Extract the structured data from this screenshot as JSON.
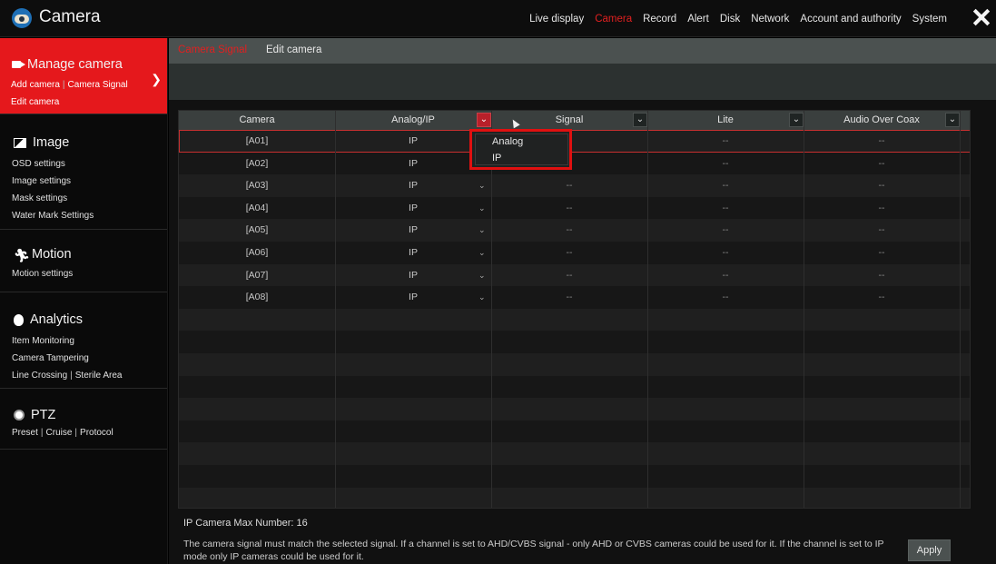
{
  "app": {
    "title": "Camera"
  },
  "topnav": [
    {
      "label": "Live display",
      "active": false
    },
    {
      "label": "Camera",
      "active": true
    },
    {
      "label": "Record",
      "active": false
    },
    {
      "label": "Alert",
      "active": false
    },
    {
      "label": "Disk",
      "active": false
    },
    {
      "label": "Network",
      "active": false
    },
    {
      "label": "Account and authority",
      "active": false
    },
    {
      "label": "System",
      "active": false
    }
  ],
  "sidebar": {
    "manage": {
      "title": "Manage camera",
      "links": [
        "Add camera",
        "Camera Signal",
        "Edit camera"
      ]
    },
    "image": {
      "title": "Image",
      "links": [
        "OSD settings",
        "Image settings",
        "Mask settings",
        "Water Mark Settings"
      ]
    },
    "motion": {
      "title": "Motion",
      "links": [
        "Motion settings"
      ]
    },
    "analytics": {
      "title": "Analytics",
      "links": [
        "Item Monitoring",
        "Camera Tampering",
        "Line Crossing",
        "Sterile Area"
      ]
    },
    "ptz": {
      "title": "PTZ",
      "links": [
        "Preset",
        "Cruise",
        "Protocol"
      ]
    }
  },
  "subtabs": {
    "active": "Camera Signal",
    "other": "Edit camera"
  },
  "table": {
    "headers": {
      "camera": "Camera",
      "analog_ip": "Analog/IP",
      "signal": "Signal",
      "lite": "Lite",
      "coax": "Audio Over Coax"
    },
    "rows": [
      {
        "camera": "[A01]",
        "mode": "IP",
        "signal": "--",
        "lite": "--",
        "coax": "--"
      },
      {
        "camera": "[A02]",
        "mode": "IP",
        "signal": "--",
        "lite": "--",
        "coax": "--"
      },
      {
        "camera": "[A03]",
        "mode": "IP",
        "signal": "--",
        "lite": "--",
        "coax": "--"
      },
      {
        "camera": "[A04]",
        "mode": "IP",
        "signal": "--",
        "lite": "--",
        "coax": "--"
      },
      {
        "camera": "[A05]",
        "mode": "IP",
        "signal": "--",
        "lite": "--",
        "coax": "--"
      },
      {
        "camera": "[A06]",
        "mode": "IP",
        "signal": "--",
        "lite": "--",
        "coax": "--"
      },
      {
        "camera": "[A07]",
        "mode": "IP",
        "signal": "--",
        "lite": "--",
        "coax": "--"
      },
      {
        "camera": "[A08]",
        "mode": "IP",
        "signal": "--",
        "lite": "--",
        "coax": "--"
      }
    ]
  },
  "dropdown": {
    "options": [
      "Analog",
      "IP"
    ]
  },
  "footer": {
    "max_number": "IP Camera Max Number: 16",
    "note": "The camera signal must match the selected signal. If a channel is set to AHD/CVBS signal - only AHD or CVBS cameras could be used for it. If the channel is set to IP mode only IP cameras could be used for it.",
    "apply_label": "Apply"
  },
  "colors": {
    "accent": "#e5181c",
    "header_band": "#4b5150"
  }
}
